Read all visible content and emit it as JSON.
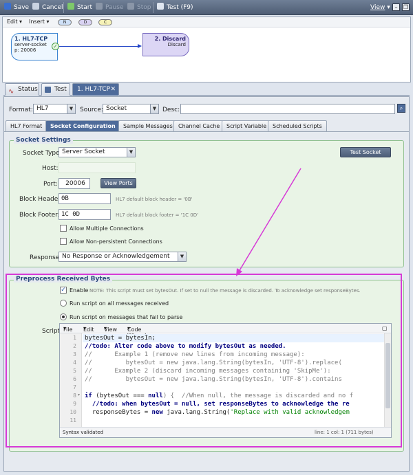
{
  "toolbar": {
    "save": "Save",
    "cancel": "Cancel",
    "start": "Start",
    "pause": "Pause",
    "stop": "Stop",
    "test": "Test (F9)",
    "view": "View"
  },
  "canvas": {
    "menu": {
      "edit": "Edit",
      "insert": "Insert"
    },
    "pills": [
      "N",
      "D",
      "C"
    ],
    "node1": {
      "title": "1. HL7-TCP",
      "line1": "server-socket",
      "line2": "p: 20006"
    },
    "node2": {
      "title": "2. Discard",
      "line1": "Discard"
    }
  },
  "tabs": {
    "status": "Status",
    "test": "Test",
    "active": "1. HL7-TCP"
  },
  "format_row": {
    "format_label": "Format:",
    "format_value": "HL7",
    "source_label": "Source:",
    "source_value": "Socket",
    "desc_label": "Desc:",
    "desc_value": ""
  },
  "subtabs": [
    "HL7 Format",
    "Socket Configuration",
    "Sample Messages",
    "Channel Cache",
    "Script Variable",
    "Scheduled Scripts"
  ],
  "socket": {
    "title": "Socket Settings",
    "type_label": "Socket Type:",
    "type_value": "Server Socket",
    "test_socket": "Test Socket",
    "host_label": "Host:",
    "host_value": "",
    "port_label": "Port:",
    "port_value": "20006",
    "view_ports": "View Ports",
    "header_label": "Block Header:",
    "header_value": "0B",
    "header_hint": "HL7 default block header = '0B'",
    "footer_label": "Block Footer:",
    "footer_value": "1C 0D",
    "footer_hint": "HL7 default block footer = '1C 0D'",
    "allow_multiple": "Allow Multiple Connections",
    "allow_nonpersistent": "Allow Non-persistent Connections",
    "response_label": "Response:",
    "response_value": "No Response or Acknowledgement"
  },
  "preprocess": {
    "title": "Preprocess Received Bytes",
    "enable": "Enable",
    "note": "NOTE: This script must set bytesOut. If set to null the message is discarded. To acknowledge set responseBytes.",
    "run_all": "Run script on all messages received",
    "run_fail": "Run script on messages that fail to parse",
    "script_label": "Script:"
  },
  "editor": {
    "menu": [
      "File",
      "Edit",
      "View",
      "Code Wizard"
    ],
    "lines": [
      "1",
      "2",
      "3",
      "4",
      "5",
      "6",
      "7",
      "8",
      "9",
      "10",
      "11"
    ],
    "code": {
      "l1": "bytesOut = bytesIn;",
      "l2": "//todo: Alter code above to modify bytesOut as needed.",
      "l3": "//      Example 1 (remove new lines from incoming message):",
      "l4": "//         bytesOut = new java.lang.String(bytesIn, 'UTF-8').replace(",
      "l5": "//      Example 2 (discard incoming messages containing 'SkipMe'):",
      "l6": "//         bytesOut = new java.lang.String(bytesIn, 'UTF-8').contains",
      "l7": "",
      "l8a": "if",
      "l8b": " (bytesOut === ",
      "l8c": "null",
      "l8d": ") {  //When null, the message is discarded and no f",
      "l9": "  //todo: when bytesOut = null, set responseBytes to acknowledge the re",
      "l10a": "  responseBytes = ",
      "l10b": "new",
      "l10c": " java.lang.String(",
      "l10d": "'Replace with valid acknowledgem"
    },
    "status_left": "Syntax validated",
    "status_right": "line: 1  col: 1   (711 bytes)"
  }
}
